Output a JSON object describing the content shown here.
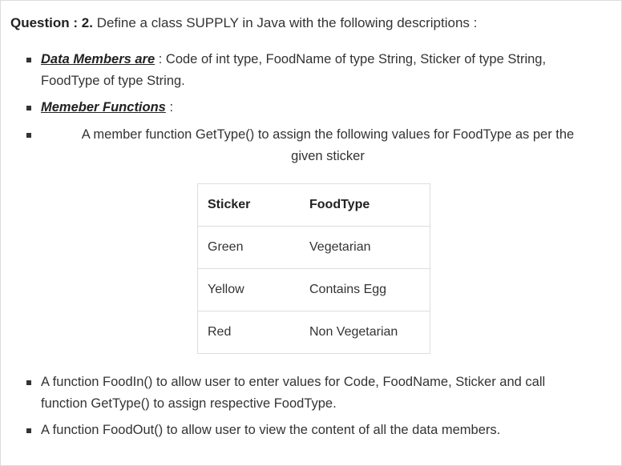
{
  "question": {
    "label": "Question : 2.",
    "text": " Define a class SUPPLY in Java with the following descriptions :"
  },
  "items": [
    {
      "heading": "Data Members are",
      "line1": " : Code of int type, FoodName of type String, Sticker of type String,",
      "line2": "FoodType of type String."
    },
    {
      "heading": "Memeber Functions",
      "line1": " :"
    },
    {
      "line1": "A member function GetType() to assign the following values for FoodType as per the",
      "line2": "given sticker"
    },
    {
      "line1": "A function FoodIn() to allow user to enter values for Code, FoodName, Sticker and call",
      "line2": "function GetType() to assign respective FoodType."
    },
    {
      "line1": "A function FoodOut() to allow user to view the content of all the data members."
    }
  ],
  "table": {
    "headers": [
      "Sticker",
      "FoodType"
    ],
    "rows": [
      [
        "Green",
        "Vegetarian"
      ],
      [
        "Yellow",
        "Contains Egg"
      ],
      [
        "Red",
        "Non Vegetarian"
      ]
    ]
  }
}
